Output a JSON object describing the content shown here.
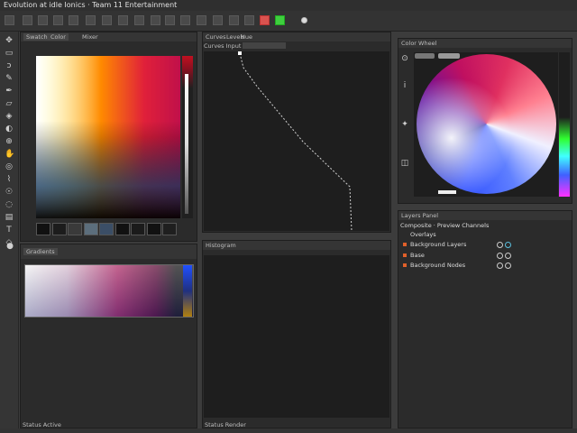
{
  "window": {
    "title": "Evolution at idle Ionics · Team 11 Entertainment"
  },
  "toolbar": {
    "buttons": [
      "new-icon",
      "pen-icon",
      "brush-icon",
      "fill-icon",
      "stamp-icon",
      "select-icon",
      "zoom-icon",
      "text-icon",
      "shape-icon",
      "grid-icon",
      "layer-icon",
      "export-icon",
      "image-icon",
      "settings-icon",
      "crop-icon",
      "camera-icon",
      "screen-icon",
      "color-red",
      "color-green",
      "color-white"
    ],
    "colors": {
      "red": "#d9534f",
      "green": "#3ecf3e"
    }
  },
  "tools": [
    "move-icon",
    "marquee-icon",
    "lasso-icon",
    "brush-icon",
    "pen-icon",
    "eraser-icon",
    "fill-icon",
    "dodge-icon",
    "clone-icon",
    "hand-icon",
    "zoom-icon",
    "eyedropper-icon",
    "smudge-icon",
    "blur-icon",
    "gradient-icon",
    "text-icon",
    "shape-icon",
    "path-icon"
  ],
  "color_picker": {
    "tabs": [
      "Swatches",
      "Color",
      "Mixer"
    ],
    "swatches": [
      "#111111",
      "#1c1c1c",
      "#3a3a3a",
      "#5c6e7c",
      "#3b4e66",
      "#111111",
      "#1b1b1b",
      "#111111",
      "#1f1f1f"
    ]
  },
  "curves": {
    "tabs": [
      "Curves",
      "Levels",
      "Hue"
    ],
    "label": "Curves Input"
  },
  "lower_left": {
    "title": "Gradients"
  },
  "lower_mid": {
    "title": "Histogram"
  },
  "wheel": {
    "title": "Color Wheel"
  },
  "layers": {
    "title": "Layers Panel",
    "header": "Composite · Preview Channels",
    "rows": [
      "Overlays",
      "Background Layers",
      "Base",
      "Background Nodes"
    ]
  },
  "footer": {
    "left": "Status Active",
    "mid": "Status Render"
  }
}
